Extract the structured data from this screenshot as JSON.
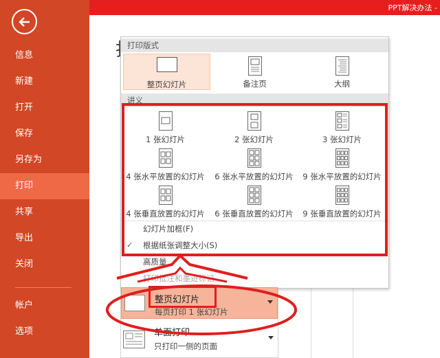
{
  "window": {
    "title": "PPT解决办法 -"
  },
  "sidebar": {
    "items": [
      {
        "label": "信息"
      },
      {
        "label": "新建"
      },
      {
        "label": "打开"
      },
      {
        "label": "保存"
      },
      {
        "label": "另存为"
      },
      {
        "label": "打印"
      },
      {
        "label": "共享"
      },
      {
        "label": "导出"
      },
      {
        "label": "关闭"
      },
      {
        "label": "帐户"
      },
      {
        "label": "选项"
      }
    ],
    "active": "打印"
  },
  "background": {
    "title": "打"
  },
  "panel": {
    "layout_header": "打印版式",
    "layouts": [
      {
        "label": "整页幻灯片",
        "icon": "full-page-slide-icon"
      },
      {
        "label": "备注页",
        "icon": "notes-page-icon"
      },
      {
        "label": "大纲",
        "icon": "outline-icon"
      }
    ],
    "handouts_header": "讲义",
    "handouts": [
      {
        "label": "1 张幻灯片",
        "icon": "handout-1-icon"
      },
      {
        "label": "2 张幻灯片",
        "icon": "handout-2-icon"
      },
      {
        "label": "3 张幻灯片",
        "icon": "handout-3-icon"
      },
      {
        "label": "4 张水平放置的幻灯片",
        "icon": "handout-4h-icon"
      },
      {
        "label": "6 张水平放置的幻灯片",
        "icon": "handout-6h-icon"
      },
      {
        "label": "9 张水平放置的幻灯片",
        "icon": "handout-9h-icon"
      },
      {
        "label": "4 张垂直放置的幻灯片",
        "icon": "handout-4v-icon"
      },
      {
        "label": "6 张垂直放置的幻灯片",
        "icon": "handout-6v-icon"
      },
      {
        "label": "9 张垂直放置的幻灯片",
        "icon": "handout-9v-icon"
      }
    ],
    "options": [
      {
        "label": "幻灯片加框(F)",
        "checked": false
      },
      {
        "label": "根据纸张调整大小(S)",
        "checked": true
      },
      {
        "label": "高质量",
        "checked": false
      },
      {
        "label": "打印批注和墨迹标记",
        "checked": false,
        "disabled": true
      }
    ]
  },
  "selector": {
    "title": "整页幻灯片",
    "subtitle": "每页打印 1 张幻灯片"
  },
  "selector2": {
    "title": "单面打印",
    "subtitle": "只打印一侧的页面"
  },
  "colors": {
    "sidebar": "#d24726",
    "active": "#f06947",
    "annotation": "#e01e1e",
    "selected": "#f6b49a"
  }
}
